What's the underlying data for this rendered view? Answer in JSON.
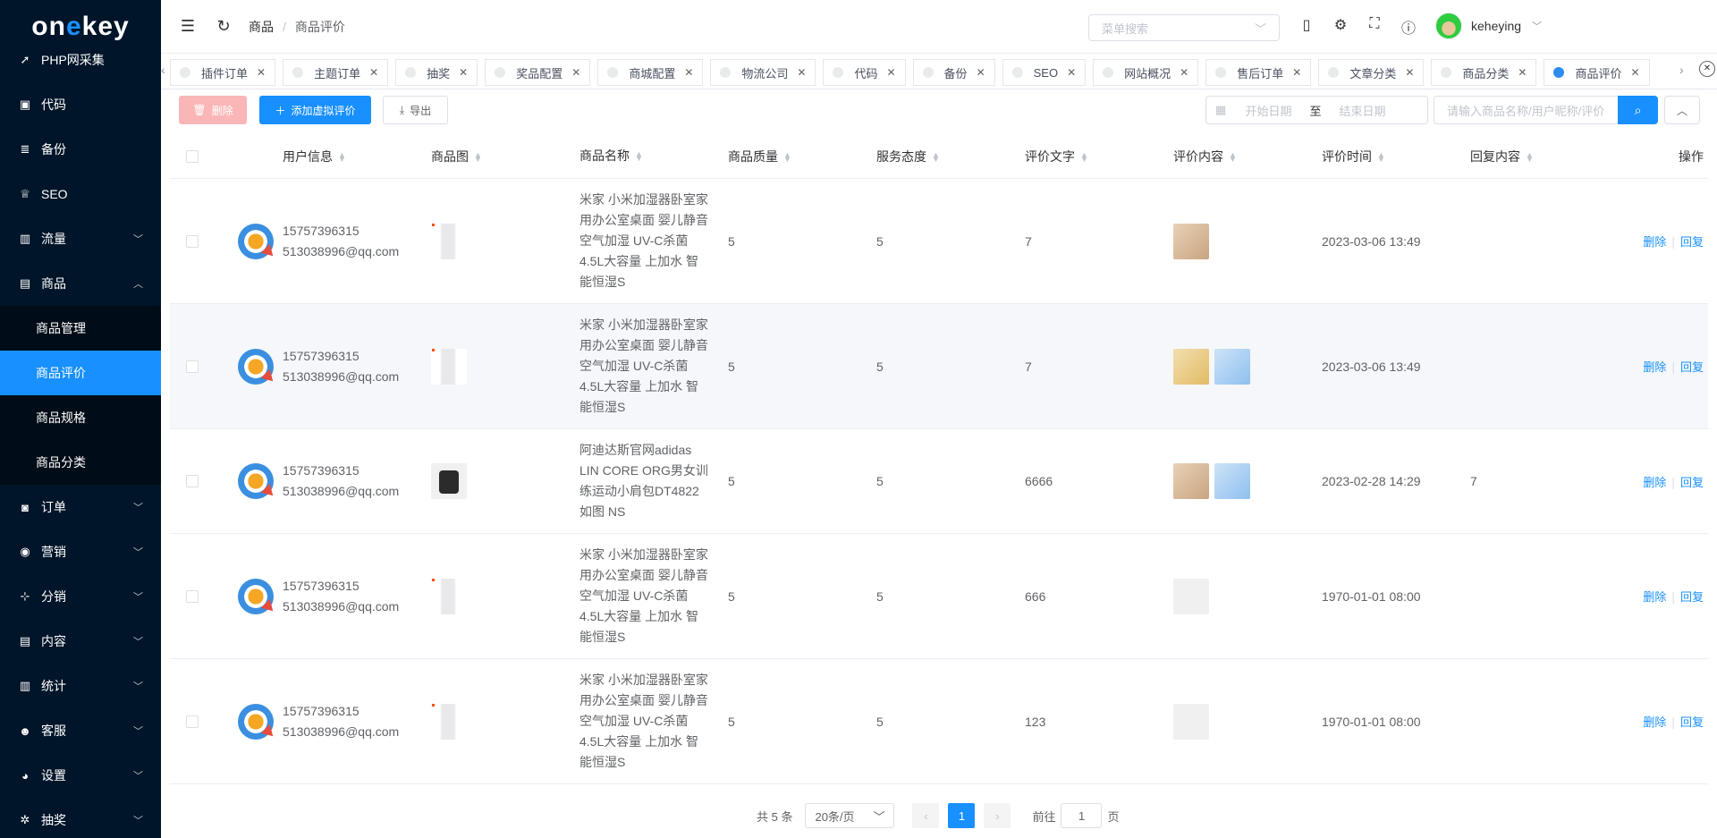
{
  "sidebar": {
    "logo": {
      "part1": "on",
      "accent": "e",
      "part2": "key"
    },
    "items": [
      {
        "label": "PHP网采集",
        "icon": "plugin-icon"
      },
      {
        "label": "代码",
        "icon": "code-icon"
      },
      {
        "label": "备份",
        "icon": "database-icon"
      },
      {
        "label": "SEO",
        "icon": "trophy-icon"
      },
      {
        "label": "流量",
        "icon": "bar-chart-icon"
      },
      {
        "label": "商品",
        "icon": "shopping-bag-icon"
      }
    ],
    "sub_items": [
      {
        "label": "商品管理"
      },
      {
        "label": "商品评价"
      },
      {
        "label": "商品规格"
      },
      {
        "label": "商品分类"
      }
    ],
    "items_after": [
      {
        "label": "订单",
        "icon": "order-icon"
      },
      {
        "label": "营销",
        "icon": "marketing-icon"
      },
      {
        "label": "分销",
        "icon": "distribution-icon"
      },
      {
        "label": "内容",
        "icon": "content-icon"
      },
      {
        "label": "统计",
        "icon": "statistics-icon"
      },
      {
        "label": "客服",
        "icon": "customer-service-icon"
      },
      {
        "label": "设置",
        "icon": "settings-icon"
      },
      {
        "label": "抽奖",
        "icon": "lottery-icon"
      }
    ]
  },
  "header": {
    "breadcrumb": [
      "商品",
      "商品评价"
    ],
    "menu_search_placeholder": "菜单搜索",
    "username": "keheying"
  },
  "tabs": [
    {
      "label": "插件订单"
    },
    {
      "label": "主题订单"
    },
    {
      "label": "抽奖"
    },
    {
      "label": "奖品配置"
    },
    {
      "label": "商城配置"
    },
    {
      "label": "物流公司"
    },
    {
      "label": "代码"
    },
    {
      "label": "备份"
    },
    {
      "label": "SEO"
    },
    {
      "label": "网站概况"
    },
    {
      "label": "售后订单"
    },
    {
      "label": "文章分类"
    },
    {
      "label": "商品分类"
    },
    {
      "label": "商品评价",
      "active": true
    }
  ],
  "toolbar": {
    "delete_label": "删除",
    "add_label": "添加虚拟评价",
    "export_label": "导出",
    "date_start_placeholder": "开始日期",
    "date_to": "至",
    "date_end_placeholder": "结束日期",
    "search_placeholder": "请输入商品名称/用户昵称/评价"
  },
  "table": {
    "columns": [
      "用户信息",
      "商品图",
      "商品名称",
      "商品质量",
      "服务态度",
      "评价文字",
      "评价内容",
      "评价时间",
      "回复内容",
      "操作"
    ],
    "rows": [
      {
        "phone": "15757396315",
        "email": "513038996@qq.com",
        "product_name": "米家 小米加湿器卧室家用办公室桌面 婴儿静音空气加湿 UV-C杀菌 4.5L大容量 上加水 智能恒湿S",
        "quality": "5",
        "service": "5",
        "review_text": "7",
        "review_time": "2023-03-06 13:49",
        "reply": "",
        "op_delete": "删除",
        "op_reply": "回复"
      },
      {
        "phone": "15757396315",
        "email": "513038996@qq.com",
        "product_name": "米家 小米加湿器卧室家用办公室桌面 婴儿静音空气加湿 UV-C杀菌 4.5L大容量 上加水 智能恒湿S",
        "quality": "5",
        "service": "5",
        "review_text": "7",
        "review_time": "2023-03-06 13:49",
        "reply": "",
        "op_delete": "删除",
        "op_reply": "回复"
      },
      {
        "phone": "15757396315",
        "email": "513038996@qq.com",
        "product_name": "阿迪达斯官网adidas LIN CORE ORG男女训练运动小肩包DT4822 如图 NS",
        "quality": "5",
        "service": "5",
        "review_text": "6666",
        "review_time": "2023-02-28 14:29",
        "reply": "7",
        "op_delete": "删除",
        "op_reply": "回复"
      },
      {
        "phone": "15757396315",
        "email": "513038996@qq.com",
        "product_name": "米家 小米加湿器卧室家用办公室桌面 婴儿静音空气加湿 UV-C杀菌 4.5L大容量 上加水 智能恒湿S",
        "quality": "5",
        "service": "5",
        "review_text": "666",
        "review_time": "1970-01-01 08:00",
        "reply": "",
        "op_delete": "删除",
        "op_reply": "回复"
      },
      {
        "phone": "15757396315",
        "email": "513038996@qq.com",
        "product_name": "米家 小米加湿器卧室家用办公室桌面 婴儿静音空气加湿 UV-C杀菌 4.5L大容量 上加水 智能恒湿S",
        "quality": "5",
        "service": "5",
        "review_text": "123",
        "review_time": "1970-01-01 08:00",
        "reply": "",
        "op_delete": "删除",
        "op_reply": "回复"
      }
    ]
  },
  "pagination": {
    "total": "共 5 条",
    "page_size": "20条/页",
    "current_page": "1",
    "goto_prefix": "前往",
    "goto_value": "1",
    "goto_suffix": "页"
  }
}
